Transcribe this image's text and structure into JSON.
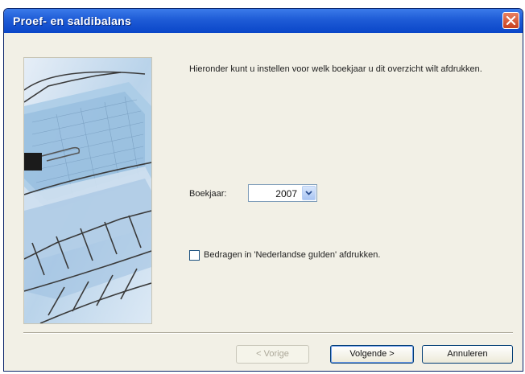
{
  "window": {
    "title": "Proef- en saldibalans"
  },
  "intro_text": "Hieronder kunt u instellen voor welk boekjaar u dit overzicht wilt afdrukken.",
  "year": {
    "label": "Boekjaar:",
    "value": "2007"
  },
  "checkbox": {
    "label": "Bedragen in 'Nederlandse gulden' afdrukken.",
    "checked": false
  },
  "buttons": {
    "back": "< Vorige",
    "next": "Volgende >",
    "cancel": "Annuleren"
  },
  "icons": {
    "close": "close-icon",
    "dropdown": "chevron-down-icon",
    "illustration": "document-tray-illustration"
  },
  "colors": {
    "titlebar": "#0a46c8",
    "dialog": "#f2f0e6",
    "close": "#c8401e"
  }
}
